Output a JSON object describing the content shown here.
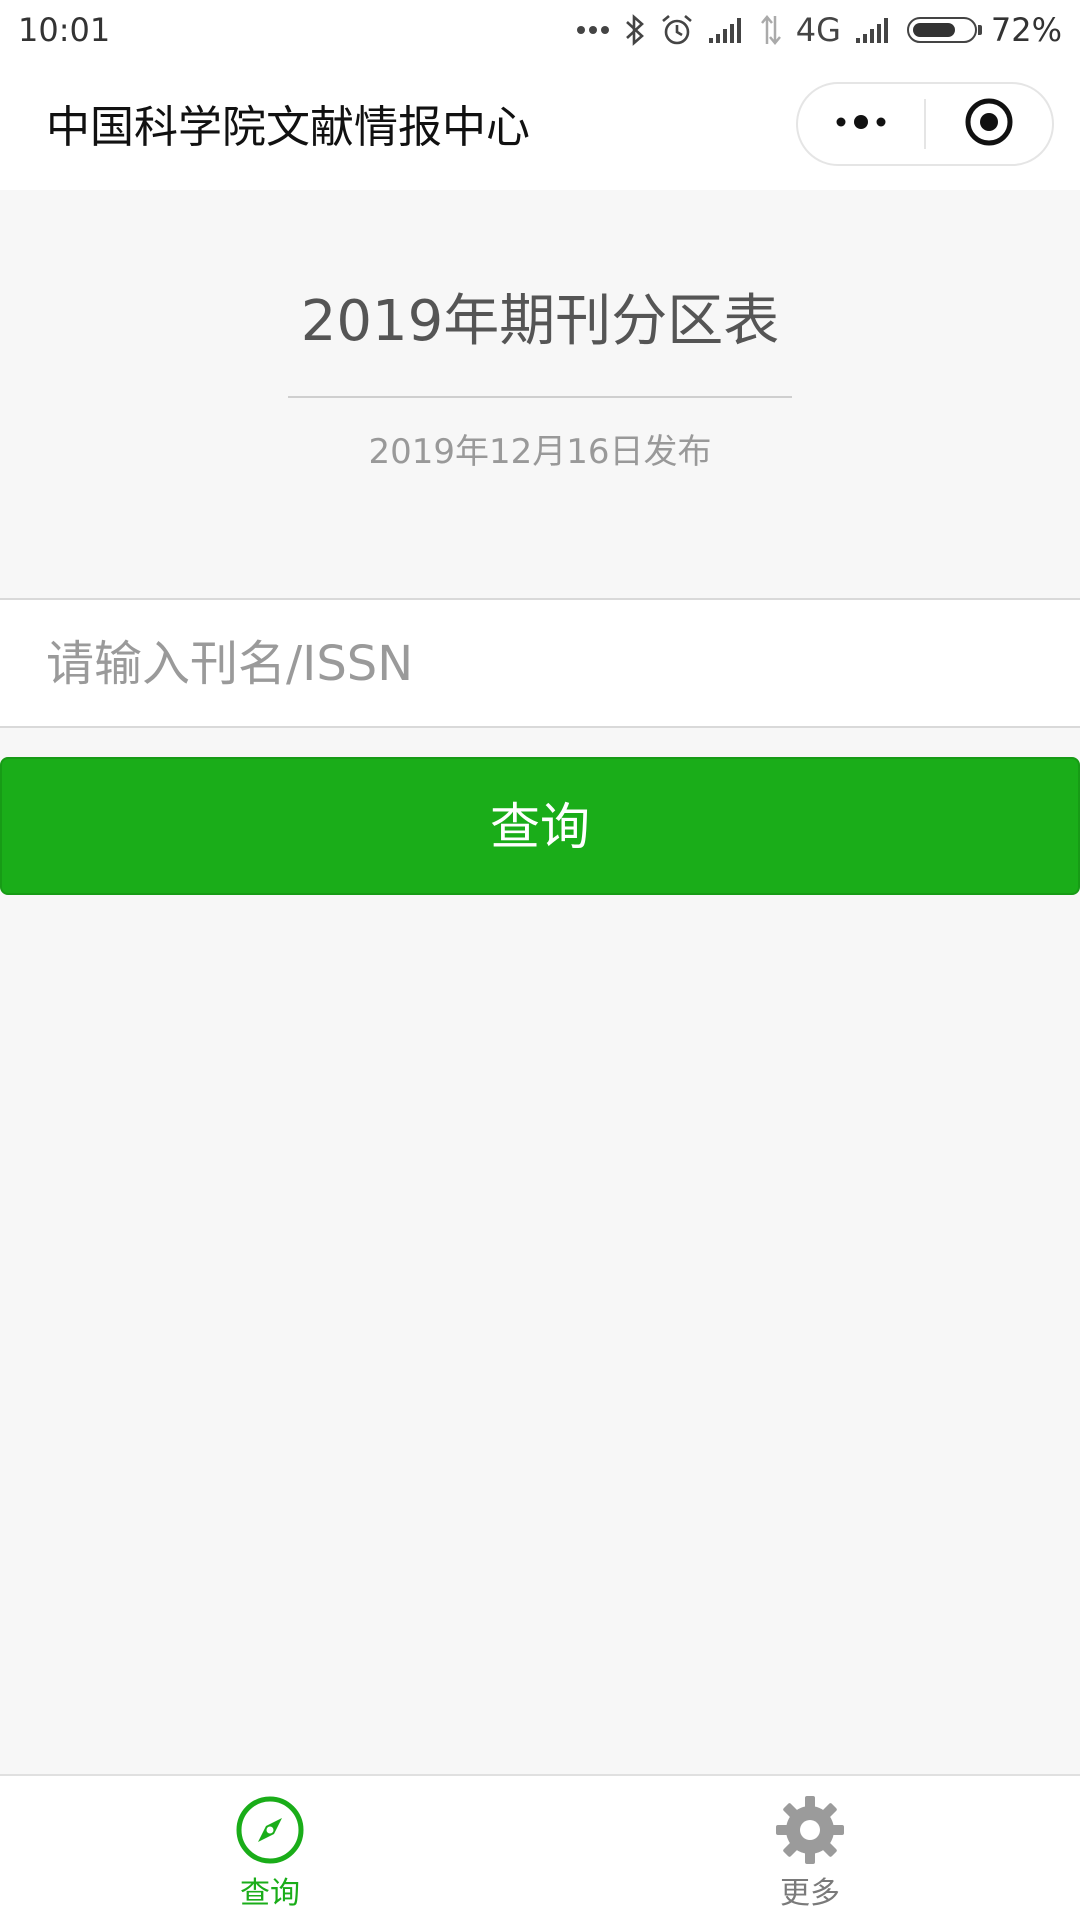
{
  "status_bar": {
    "time": "10:01",
    "network": "4G",
    "battery_percent": "72%",
    "battery_level": 0.72,
    "icons": [
      "more-dots-icon",
      "bluetooth-icon",
      "alarm-icon",
      "signal-icon",
      "data-transfer-icon",
      "signal-icon",
      "battery-icon"
    ]
  },
  "nav": {
    "title": "中国科学院文献情报中心",
    "capsule_icons": [
      "more-options-icon",
      "close-miniprogram-icon"
    ]
  },
  "header": {
    "title": "2019年期刊分区表",
    "date": "2019年12月16日发布"
  },
  "search": {
    "value": "",
    "placeholder": "请输入刊名/ISSN"
  },
  "query_button": {
    "label": "查询"
  },
  "tabbar": {
    "items": [
      {
        "label": "查询",
        "icon": "compass-icon",
        "active": true
      },
      {
        "label": "更多",
        "icon": "gear-icon",
        "active": false
      }
    ]
  },
  "colors": {
    "accent": "#1aad19",
    "background": "#f7f7f7",
    "inactive": "#7a7a7a"
  }
}
